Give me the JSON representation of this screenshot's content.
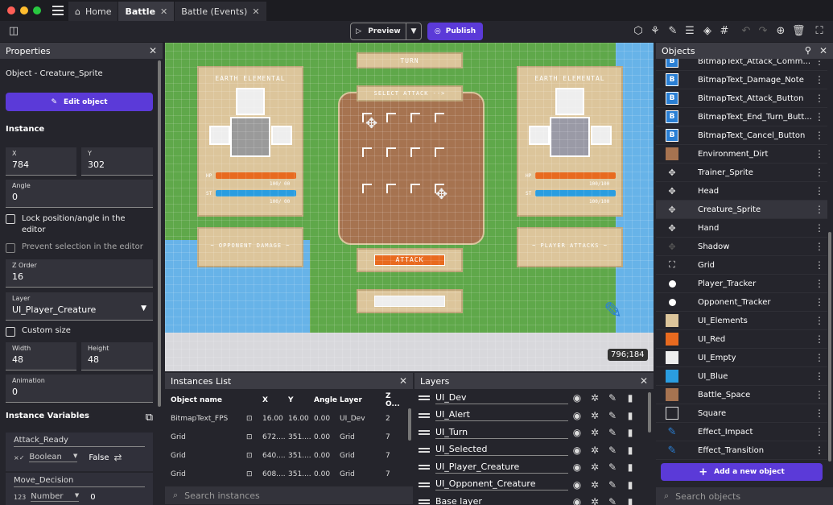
{
  "tabs": [
    {
      "label": "Home",
      "closable": false
    },
    {
      "label": "Battle",
      "closable": true
    },
    {
      "label": "Battle (Events)",
      "closable": true
    }
  ],
  "toolbar": {
    "preview_label": "Preview",
    "publish_label": "Publish"
  },
  "properties": {
    "panel_title": "Properties",
    "object_label": "Object  - Creature_Sprite",
    "edit_button": "Edit object",
    "instance_heading": "Instance",
    "x_label": "X",
    "x_value": "784",
    "y_label": "Y",
    "y_value": "302",
    "angle_label": "Angle",
    "angle_value": "0",
    "lock_label": "Lock position/angle in the editor",
    "prevent_label": "Prevent selection in the editor",
    "zorder_label": "Z Order",
    "zorder_value": "16",
    "layer_label": "Layer",
    "layer_value": "UI_Player_Creature",
    "custom_size_label": "Custom size",
    "width_label": "Width",
    "width_value": "48",
    "height_label": "Height",
    "height_value": "48",
    "animation_label": "Animation",
    "animation_value": "0",
    "vars_heading": "Instance Variables",
    "variables": [
      {
        "name": "Attack_Ready",
        "type": "Boolean",
        "value": "False"
      },
      {
        "name": "Move_Decision",
        "type": "Number",
        "value": "0"
      }
    ]
  },
  "canvas": {
    "turn_label": "TURN",
    "select_attack_label": "SELECT ATTACK -->",
    "left_card_title": "EARTH ELEMENTAL",
    "right_card_title": "EARTH ELEMENTAL",
    "hp_label": "HP",
    "st_label": "ST",
    "left_hp_text": "100/ 00",
    "left_st_text": "100/ 00",
    "right_hp_text": "100/100",
    "right_st_text": "100/100",
    "opponent_damage_label": "~ OPPONENT DAMAGE ~",
    "player_attacks_label": "~ PLAYER ATTACKS ~",
    "attack_button_label": "ATTACK",
    "cursor_coords": "796;184"
  },
  "instances": {
    "panel_title": "Instances List",
    "columns": [
      "Object name",
      "X",
      "Y",
      "Angle",
      "Layer",
      "Z O..."
    ],
    "rows": [
      {
        "name": "BitmapText_FPS",
        "x": "16.00",
        "y": "16.00",
        "angle": "0.00",
        "layer": "UI_Dev",
        "z": "2"
      },
      {
        "name": "Grid",
        "x": "672....",
        "y": "351....",
        "angle": "0.00",
        "layer": "Grid",
        "z": "7"
      },
      {
        "name": "Grid",
        "x": "640....",
        "y": "351....",
        "angle": "0.00",
        "layer": "Grid",
        "z": "7"
      },
      {
        "name": "Grid",
        "x": "608....",
        "y": "351....",
        "angle": "0.00",
        "layer": "Grid",
        "z": "7"
      }
    ],
    "search_placeholder": "Search instances"
  },
  "layers": {
    "panel_title": "Layers",
    "items": [
      "UI_Dev",
      "UI_Alert",
      "UI_Turn",
      "UI_Selected",
      "UI_Player_Creature",
      "UI_Opponent_Creature",
      "Base layer"
    ]
  },
  "objects": {
    "panel_title": "Objects",
    "items": [
      {
        "name": "BitmapText_Attack_Comm...",
        "icon": "bitmap-text",
        "color": "#2a7fd4"
      },
      {
        "name": "BitmapText_Damage_Note",
        "icon": "bitmap-text",
        "color": "#2a7fd4"
      },
      {
        "name": "BitmapText_Attack_Button",
        "icon": "bitmap-text",
        "color": "#2a7fd4"
      },
      {
        "name": "BitmapText_End_Turn_Butt...",
        "icon": "bitmap-text",
        "color": "#2a7fd4"
      },
      {
        "name": "BitmapText_Cancel_Button",
        "icon": "bitmap-text",
        "color": "#2a7fd4"
      },
      {
        "name": "Environment_Dirt",
        "icon": "swatch",
        "color": "#a67350"
      },
      {
        "name": "Trainer_Sprite",
        "icon": "sprite",
        "color": "#dddddd"
      },
      {
        "name": "Head",
        "icon": "sprite",
        "color": "#dddddd"
      },
      {
        "name": "Creature_Sprite",
        "icon": "sprite",
        "color": "#cccccc"
      },
      {
        "name": "Hand",
        "icon": "sprite",
        "color": "#dddddd"
      },
      {
        "name": "Shadow",
        "icon": "sprite",
        "color": "#555555"
      },
      {
        "name": "Grid",
        "icon": "corners",
        "color": "#dddddd"
      },
      {
        "name": "Player_Tracker",
        "icon": "circle",
        "color": "#ffffff"
      },
      {
        "name": "Opponent_Tracker",
        "icon": "circle",
        "color": "#ffffff"
      },
      {
        "name": "UI_Elements",
        "icon": "swatch",
        "color": "#dcc59b"
      },
      {
        "name": "UI_Red",
        "icon": "swatch",
        "color": "#e86a1f"
      },
      {
        "name": "UI_Empty",
        "icon": "swatch",
        "color": "#eeeeee"
      },
      {
        "name": "UI_Blue",
        "icon": "swatch",
        "color": "#2a9de0"
      },
      {
        "name": "Battle_Space",
        "icon": "swatch",
        "color": "#a67350"
      },
      {
        "name": "Square",
        "icon": "outline",
        "color": "#dddddd"
      },
      {
        "name": "Effect_Impact",
        "icon": "effect",
        "color": "#2a7fd4"
      },
      {
        "name": "Effect_Transition",
        "icon": "effect",
        "color": "#2a7fd4"
      }
    ],
    "add_button": "Add a new object",
    "search_placeholder": "Search objects"
  },
  "colors": {
    "accent": "#5b3ad8",
    "hp_bar": "#e86a1f",
    "st_bar": "#2a9de0"
  }
}
